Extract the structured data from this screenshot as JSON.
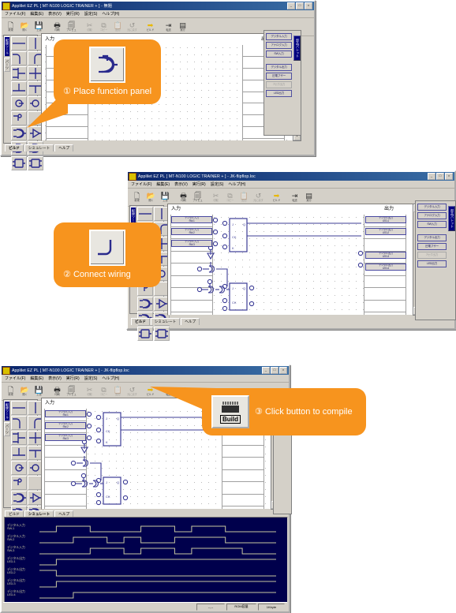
{
  "app": {
    "title": "Applilet EZ PL [ MT-N100 LOGIC TRAINER + ] - 無題",
    "title_doc": "Applilet EZ PL [ MT-N100 LOGIC TRAINER + ] - JK-flipflop.loc",
    "menus": [
      "ファイル(F)",
      "編集(E)",
      "表示(V)",
      "実行(R)",
      "設定(S)",
      "ヘルプ(H)"
    ],
    "window_buttons": [
      "_",
      "□",
      "×"
    ]
  },
  "toolbar": {
    "items": [
      {
        "name": "new-button",
        "glyph": "🗋",
        "caption": "新規"
      },
      {
        "name": "open-button",
        "glyph": "📂",
        "caption": "開く"
      },
      {
        "name": "save-button",
        "glyph": "💾",
        "caption": "上書"
      },
      {
        "name": "print-button",
        "glyph": "🖶",
        "caption": "印刷"
      },
      {
        "name": "preview-button",
        "glyph": "🗐",
        "caption": "プレビュ"
      },
      {
        "name": "cut-button",
        "glyph": "✂",
        "caption": "切取"
      },
      {
        "name": "copy-button",
        "glyph": "⧉",
        "caption": "コピー"
      },
      {
        "name": "paste-button",
        "glyph": "📋",
        "caption": "貼付"
      },
      {
        "name": "undo-button",
        "glyph": "↺",
        "caption": "元に戻す"
      },
      {
        "name": "build-run-button",
        "glyph": "➡",
        "caption": "ビルド"
      },
      {
        "name": "download-button",
        "glyph": "⇥",
        "caption": "転送"
      },
      {
        "name": "compile-button",
        "glyph": "▤",
        "caption": "実行"
      }
    ]
  },
  "palette": {
    "tabs": [
      {
        "label": "配線ツール",
        "selected": true
      },
      {
        "label": "パーツ",
        "selected": false
      }
    ],
    "cells": [
      "wire-horizontal-icon",
      "wire-vertical-icon",
      "wire-corner-ul-icon",
      "wire-corner-ur-icon",
      "wire-tee-left-icon",
      "wire-cross-icon",
      "wire-tee-up-icon",
      "wire-tee-down-icon",
      "terminal-in-icon",
      "terminal-out-icon",
      "nc-terminal-icon",
      "blank-icon",
      "and-gate-icon",
      "buffer-gate-icon",
      "nand-gate-icon",
      "or-gate-icon",
      "dff-gate-icon",
      "jkff-gate-icon"
    ]
  },
  "io_panel": {
    "tab_label": "部品パレット",
    "inputs": [
      {
        "label": "デジタル入力",
        "enabled": true
      },
      {
        "label": "アナログ入力",
        "enabled": true
      },
      {
        "label": "SW入力",
        "enabled": true
      }
    ],
    "outputs": [
      {
        "label": "デジタル出力",
        "enabled": true
      },
      {
        "label": "圧電ブザー",
        "enabled": true
      },
      {
        "label": "7セグ出力",
        "enabled": false
      },
      {
        "label": "LED出力",
        "enabled": true
      }
    ]
  },
  "canvas": {
    "input_label": "入力",
    "output_label": "出力",
    "input_chips": [
      {
        "line1": "デジタル入力",
        "line2": "SW-1"
      },
      {
        "line1": "デジタル入力",
        "line2": "SW-2"
      },
      {
        "line1": "デジタル入力",
        "line2": "SW-3"
      }
    ],
    "output_chips_top": [
      {
        "line1": "デジタル出力",
        "line2": "LED-1"
      },
      {
        "line1": "デジタル出力",
        "line2": "LED-2"
      }
    ],
    "output_chips_mid": [
      {
        "line1": "デジタル出力",
        "line2": "LED-3"
      },
      {
        "line1": "デジタル出力",
        "line2": "LED-4"
      }
    ]
  },
  "bottom_tabs": [
    {
      "label": "ビルド",
      "selected": true
    },
    {
      "label": "シミュレート",
      "selected": false
    },
    {
      "label": "ヘルプ",
      "selected": false
    }
  ],
  "bottom_tabs_sim": [
    {
      "label": "ビルド",
      "selected": false
    },
    {
      "label": "シミュレート",
      "selected": true
    },
    {
      "label": "ヘルプ",
      "selected": false
    }
  ],
  "simulator": {
    "traces": [
      {
        "line1": "デジタル入力",
        "line2": "SW-1",
        "pattern": [
          0,
          1,
          1,
          0,
          0,
          0,
          1,
          1,
          0,
          1,
          1,
          0,
          0,
          0
        ]
      },
      {
        "line1": "デジタル入力",
        "line2": "SW-2",
        "pattern": [
          0,
          0,
          1,
          1,
          0,
          1,
          0,
          0,
          1,
          1,
          1,
          0,
          0,
          0
        ]
      },
      {
        "line1": "デジタル入力",
        "line2": "SW-3",
        "pattern": [
          0,
          0,
          0,
          1,
          1,
          0,
          1,
          1,
          0,
          1,
          1,
          1,
          0,
          0
        ]
      },
      {
        "line1": "デジタル出力",
        "line2": "LED-1",
        "pattern": [
          0,
          1,
          1,
          1,
          1,
          1,
          1,
          1,
          1,
          1,
          1,
          1,
          1,
          1
        ]
      },
      {
        "line1": "デジタル出力",
        "line2": "LED-2",
        "pattern": [
          1,
          0,
          0,
          0,
          0,
          0,
          0,
          0,
          0,
          0,
          0,
          0,
          0,
          0
        ]
      },
      {
        "line1": "デジタル出力",
        "line2": "LED-3",
        "pattern": [
          0,
          1,
          1,
          1,
          1,
          1,
          1,
          1,
          1,
          1,
          1,
          1,
          1,
          1
        ]
      },
      {
        "line1": "デジタル出力",
        "line2": "LED-4",
        "pattern": [
          0,
          0,
          1,
          1,
          1,
          1,
          1,
          1,
          1,
          1,
          1,
          1,
          1,
          1
        ]
      }
    ]
  },
  "statusbar": {
    "coord": "--,--",
    "rom_label": "ROM容量",
    "rom_value": "1Kbyte"
  },
  "callouts": [
    {
      "num": "①",
      "text": "Place function panel",
      "icon": "logic-gate-icon"
    },
    {
      "num": "②",
      "text": "Connect wiring",
      "icon": "wire-corner-icon"
    },
    {
      "num": "③",
      "text": "Click button to compile",
      "icon": "build-button-icon",
      "button_label": "Build"
    }
  ],
  "colors": {
    "callout_orange": "#f7941e",
    "title_blue": "#0a246a",
    "chrome_gray": "#d4d0c8",
    "wave_bg": "#00004c",
    "wave_line": "#c8c8a0",
    "circuit_blue": "#3c3c96"
  }
}
